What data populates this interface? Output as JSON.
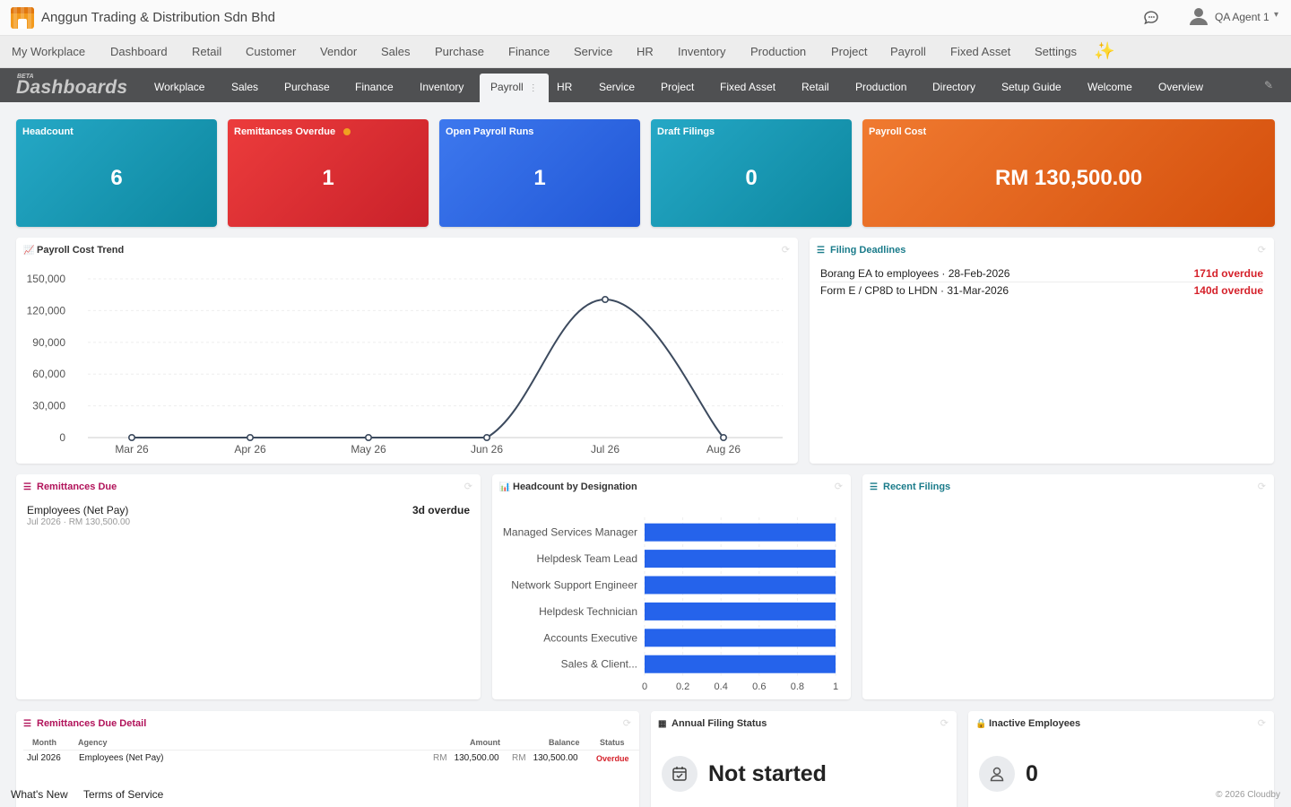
{
  "app": {
    "company": "Anggun Trading & Distribution Sdn Bhd",
    "user": "QA Agent 1"
  },
  "modules": [
    "My Workplace",
    "Dashboard",
    "Retail",
    "Customer",
    "Vendor",
    "Sales",
    "Purchase",
    "Finance",
    "Service",
    "HR",
    "Inventory",
    "Production",
    "Project",
    "Payroll",
    "Fixed Asset",
    "Settings"
  ],
  "dashbar": {
    "beta": "BETA",
    "title": "Dashboards",
    "tabs": [
      "Workplace",
      "Sales",
      "Purchase",
      "Finance",
      "Inventory",
      "Payroll",
      "HR",
      "Service",
      "Project",
      "Fixed Asset",
      "Retail",
      "Production",
      "Directory",
      "Setup Guide",
      "Welcome",
      "Overview"
    ],
    "active_tab": "Payroll"
  },
  "kpis": [
    {
      "label": "Headcount",
      "value": "6"
    },
    {
      "label": "Remittances Overdue",
      "value": "1"
    },
    {
      "label": "Open Payroll Runs",
      "value": "1"
    },
    {
      "label": "Draft Filings",
      "value": "0"
    },
    {
      "label": "Payroll Cost",
      "value": "RM 130,500.00"
    }
  ],
  "payroll_trend": {
    "title": "Payroll Cost Trend"
  },
  "filing_deadlines": {
    "title": "Filing Deadlines",
    "items": [
      {
        "text": "Borang EA to employees · 28-Feb-2026",
        "due": "171d overdue"
      },
      {
        "text": "Form E / CP8D to LHDN · 31-Mar-2026",
        "due": "140d overdue"
      }
    ]
  },
  "remittances_due": {
    "title": "Remittances Due",
    "item": {
      "name": "Employees (Net Pay)",
      "sub": "Jul 2026 · RM 130,500.00",
      "due": "3d overdue"
    }
  },
  "headcount_designation": {
    "title": "Headcount by Designation"
  },
  "recent_filings": {
    "title": "Recent Filings"
  },
  "remittance_detail": {
    "title": "Remittances Due Detail",
    "headers": {
      "month": "Month",
      "agency": "Agency",
      "amount": "Amount",
      "balance": "Balance",
      "status": "Status"
    },
    "row": {
      "month": "Jul 2026",
      "agency": "Employees (Net Pay)",
      "currency": "RM",
      "amount": "130,500.00",
      "balance": "130,500.00",
      "status": "Overdue"
    }
  },
  "annual_filing": {
    "title": "Annual Filing Status",
    "value": "Not started"
  },
  "inactive": {
    "title": "Inactive Employees",
    "value": "0"
  },
  "footer": {
    "whats_new": "What's New",
    "terms": "Terms of Service",
    "copyright": "© 2026 Cloudby"
  },
  "colors": {
    "line": "#3c4a5e",
    "bar": "#2563eb",
    "overdue": "#d5212a"
  },
  "icons": {
    "chat": "chat-bubble-icon",
    "user": "user-avatar-icon",
    "sparkle": "sparkle-icon",
    "edit": "pencil-icon",
    "refresh": "refresh-icon"
  },
  "chart_data": [
    {
      "type": "line",
      "title": "Payroll Cost Trend",
      "categories": [
        "Mar 26",
        "Apr 26",
        "May 26",
        "Jun 26",
        "Jul 26",
        "Aug 26"
      ],
      "values": [
        0,
        0,
        0,
        0,
        130500,
        0
      ],
      "ylim": [
        0,
        150000
      ],
      "yticks": [
        "0",
        "30,000",
        "60,000",
        "90,000",
        "120,000",
        "150,000"
      ],
      "smooth": true,
      "grid": true
    },
    {
      "type": "bar",
      "orientation": "horizontal",
      "title": "Headcount by Designation",
      "categories": [
        "Managed Services Manager",
        "Helpdesk Team Lead",
        "Network Support Engineer",
        "Helpdesk Technician",
        "Accounts Executive",
        "Sales & Client..."
      ],
      "values": [
        1,
        1,
        1,
        1,
        1,
        1
      ],
      "xlim": [
        0,
        1
      ],
      "xticks": [
        "0",
        "0.2",
        "0.4",
        "0.6",
        "0.8",
        "1"
      ],
      "grid": true
    }
  ]
}
